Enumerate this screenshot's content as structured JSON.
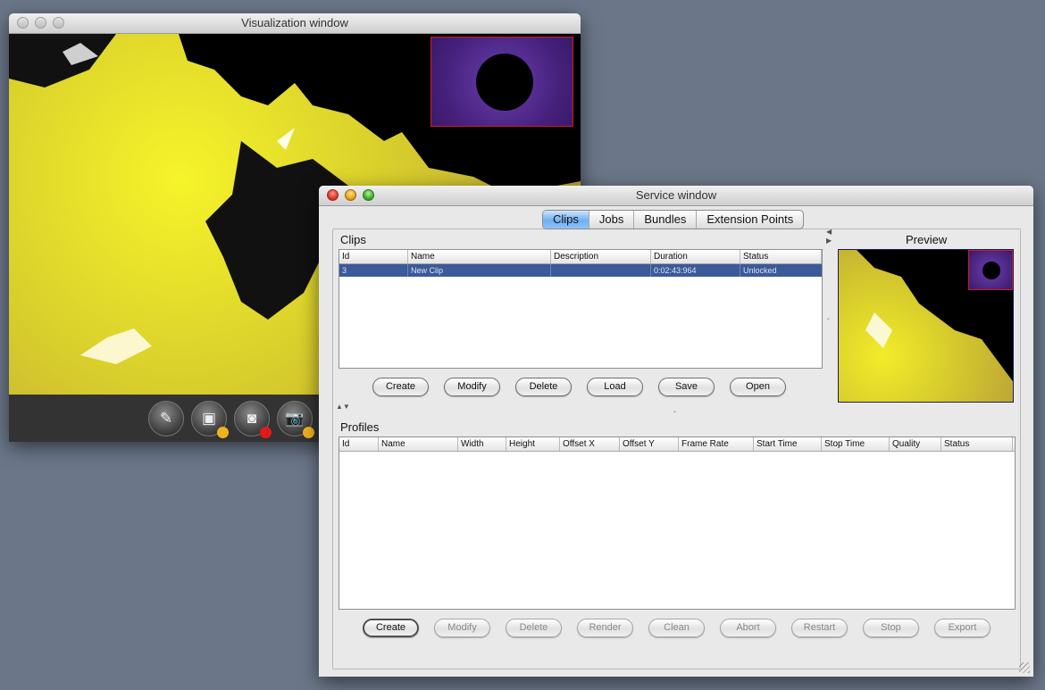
{
  "viz_window": {
    "title": "Visualization window",
    "toolbar": [
      {
        "icon": "sketch-icon",
        "glyph": "✎"
      },
      {
        "icon": "screens-database-icon",
        "glyph": "▣"
      },
      {
        "icon": "record-video-icon",
        "glyph": "◙"
      },
      {
        "icon": "camera-database-icon",
        "glyph": "📷"
      }
    ]
  },
  "svc_window": {
    "title": "Service window",
    "tabs": [
      {
        "label": "Clips",
        "active": true
      },
      {
        "label": "Jobs",
        "active": false
      },
      {
        "label": "Bundles",
        "active": false
      },
      {
        "label": "Extension Points",
        "active": false
      }
    ],
    "clips": {
      "title": "Clips",
      "columns": [
        "Id",
        "Name",
        "Description",
        "Duration",
        "Status"
      ],
      "rows": [
        {
          "id": "3",
          "name": "New Clip",
          "description": "",
          "duration": "0:02:43:964",
          "status": "Unlocked",
          "selected": true
        }
      ],
      "buttons": [
        "Create",
        "Modify",
        "Delete",
        "Load",
        "Save",
        "Open"
      ]
    },
    "preview": {
      "title": "Preview"
    },
    "profiles": {
      "title": "Profiles",
      "columns": [
        "Id",
        "Name",
        "Width",
        "Height",
        "Offset X",
        "Offset Y",
        "Frame Rate",
        "Start Time",
        "Stop Time",
        "Quality",
        "Status"
      ],
      "rows": [],
      "buttons": [
        {
          "label": "Create",
          "enabled": true
        },
        {
          "label": "Modify",
          "enabled": false
        },
        {
          "label": "Delete",
          "enabled": false
        },
        {
          "label": "Render",
          "enabled": false
        },
        {
          "label": "Clean",
          "enabled": false
        },
        {
          "label": "Abort",
          "enabled": false
        },
        {
          "label": "Restart",
          "enabled": false
        },
        {
          "label": "Stop",
          "enabled": false
        },
        {
          "label": "Export",
          "enabled": false
        }
      ]
    }
  },
  "colors": {
    "desktop": "#6b7789",
    "fractal_yellow": "#f6f42a",
    "selection": "#3b5a9a",
    "tab_active": "#6fb0f2",
    "overlay_border": "#d01a2a"
  }
}
